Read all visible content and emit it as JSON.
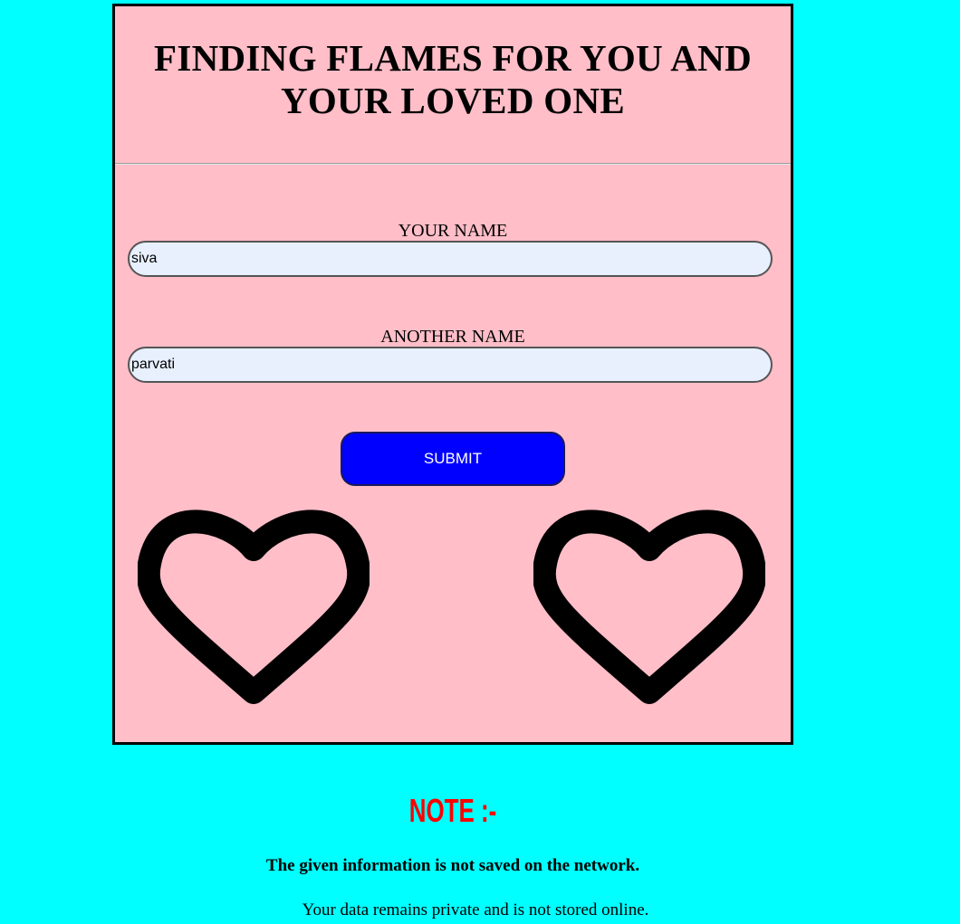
{
  "page": {
    "title": "FINDING FLAMES FOR YOU AND YOUR LOVED ONE",
    "background_color": "#00ffff",
    "card_color": "#ffbec8"
  },
  "form": {
    "your_name": {
      "label": "YOUR NAME",
      "value": "siva"
    },
    "another_name": {
      "label": "ANOTHER NAME",
      "value": "parvati"
    },
    "submit_label": "SUBMIT",
    "submit_color": "#0000ff"
  },
  "hearts": [
    {
      "icon": "heart-outline-icon"
    },
    {
      "icon": "heart-outline-icon"
    }
  ],
  "note": {
    "heading": "NOTE :-",
    "heading_color": "#ff0000",
    "strong_text": "The given information is not saved on the network.",
    "text": "Your data remains private and is not stored online."
  }
}
